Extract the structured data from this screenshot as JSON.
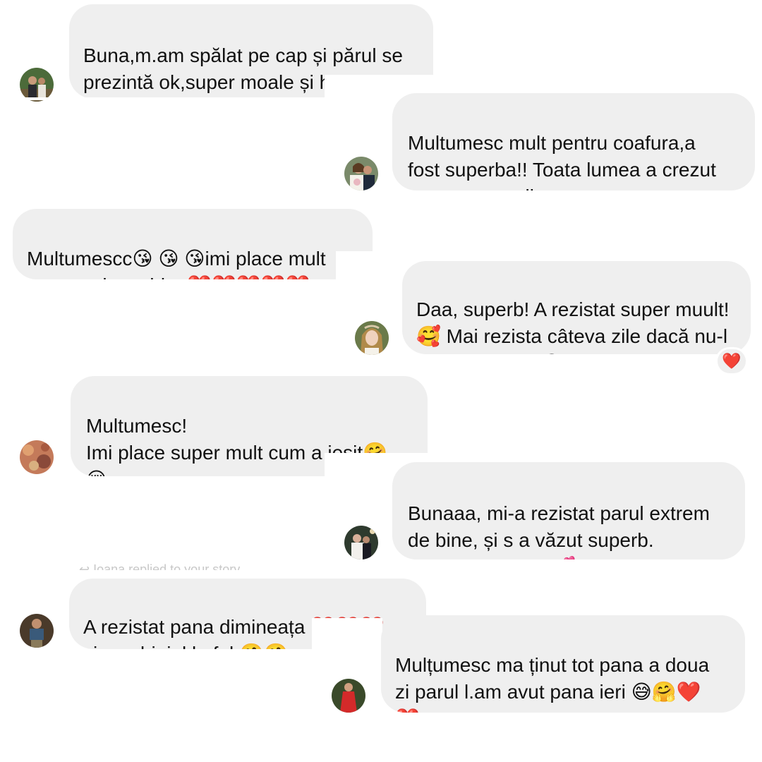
{
  "messages": [
    {
      "text": "Buna,m.am spălat pe cap și părul se\nprezintă ok,super moale și hidratat!\n😘😘😘😘",
      "avatar": "avatar-1"
    },
    {
      "text": "Multumesc mult pentru coafura,a\nfost superba!! Toata lumea a crezut\nca am extensii",
      "avatar": "avatar-2"
    },
    {
      "text": "Multumescc😘 😘 😘imi place mult\ncum m ai machiat ❤️❤️❤️❤️❤️",
      "avatar": ""
    },
    {
      "text": "Daa, superb! A rezistat super muult!\n🥰 Mai rezista câteva zile dacă nu-l\ndesprindeam. 😅",
      "avatar": "avatar-3",
      "reaction": "❤️"
    },
    {
      "text": "Multumesc!\nImi place super mult cum a iesit🤗\n😚",
      "avatar": "avatar-4"
    },
    {
      "text": "Bunaaa, mi-a rezistat parul extrem\nde bine, și s a văzut superb.\nMultumesc mult 💕",
      "avatar": "avatar-5"
    },
    {
      "text": "A rezistat pana dimineața ❤️❤️❤️\nși machiajul la fel 🤗🤗",
      "avatar": "avatar-6"
    },
    {
      "text": "Mulțumesc ma ținut tot pana a doua\nzi parul l.am avut pana ieri 😅🤗❤️\n❤️",
      "avatar": "avatar-7"
    }
  ],
  "story_note": "↩ Ioana replied to your story",
  "colors": {
    "bubble": "#efefef",
    "background": "#ffffff",
    "heart": "#e0162b"
  }
}
